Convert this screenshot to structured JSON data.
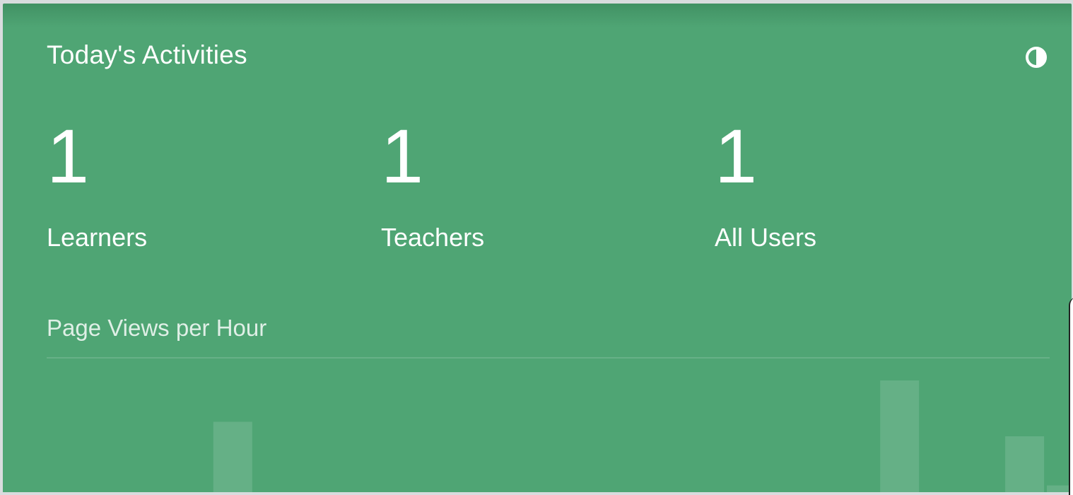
{
  "card": {
    "title": "Today's Activities",
    "icon": "contrast-icon",
    "accent_color": "#4fa574"
  },
  "stats": [
    {
      "value": "1",
      "label": "Learners"
    },
    {
      "value": "1",
      "label": "Teachers"
    },
    {
      "value": "1",
      "label": "All Users"
    }
  ],
  "chart_data": {
    "type": "bar",
    "title": "Page Views per Hour",
    "bar_color": "#ffffff",
    "bar_opacity": 0.13,
    "ymax": 10,
    "series": [
      {
        "values": [
          0,
          0,
          0,
          0,
          6.3,
          0,
          0,
          0,
          0,
          0,
          0,
          0,
          0,
          0,
          0,
          0,
          0,
          0,
          0,
          0,
          10,
          0,
          0,
          5,
          0.6
        ]
      }
    ]
  }
}
